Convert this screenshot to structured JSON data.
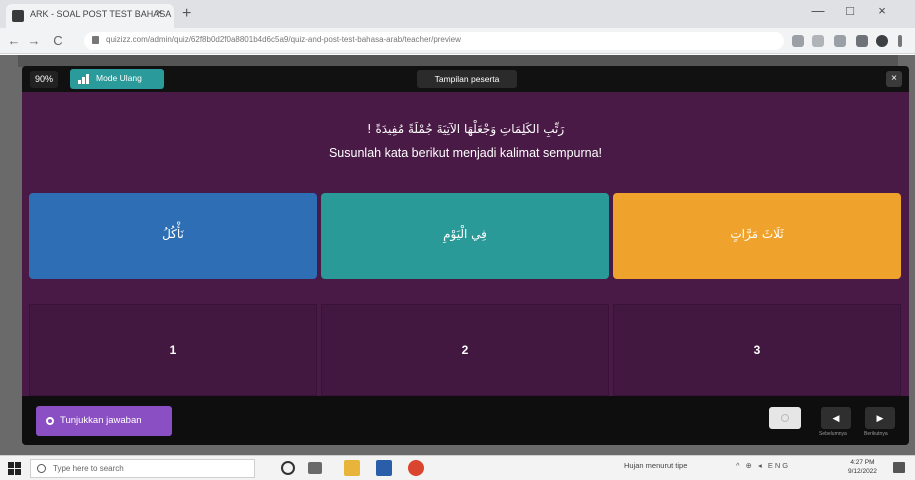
{
  "browser": {
    "tab_title": "ARK - SOAL POST TEST BAHASA",
    "tab_close": "×",
    "new_tab": "+",
    "url": "quizizz.com/admin/quiz/62f8b0d2f0a8801b4d6c5a9/quiz-and-post-test-bahasa-arab/teacher/preview",
    "nav_back": "←",
    "nav_forward": "→",
    "nav_reload": "C",
    "win_min": "—",
    "win_max": "□",
    "win_close": "×"
  },
  "modal": {
    "zoom": "90%",
    "mode_label": "Mode Ulang",
    "view_label": "Tampilan peserta",
    "close": "×",
    "question_arabic": "رَتِّبِ الكَلِمَاتِ وَجْعَلْهَا الآتِيَةَ جُمْلَةً مُفِيدَةً !",
    "question_indonesian": "Susunlah kata berikut menjadi kalimat sempurna!",
    "cards": [
      {
        "text": "نَأْكُلُ",
        "color": "#2d6eb5"
      },
      {
        "text": "فِي الْيَوْمِ",
        "color": "#2a9a99"
      },
      {
        "text": "ثَلَاثَ مَرَّاتٍ",
        "color": "#f0a32c"
      }
    ],
    "slots": [
      "1",
      "2",
      "3"
    ],
    "show_answer_label": "Tunjukkan jawaban",
    "prev_arrow": "◀",
    "next_arrow": "▶",
    "prev_caption": "Sebelumnya",
    "next_caption": "Berikutnya"
  },
  "taskbar": {
    "search_placeholder": "Type here to search",
    "weather": "Hujan menurut tipe",
    "tray": "^ ⊕ ◂ ENG",
    "time": "4:27 PM",
    "date": "9/12/2022"
  }
}
